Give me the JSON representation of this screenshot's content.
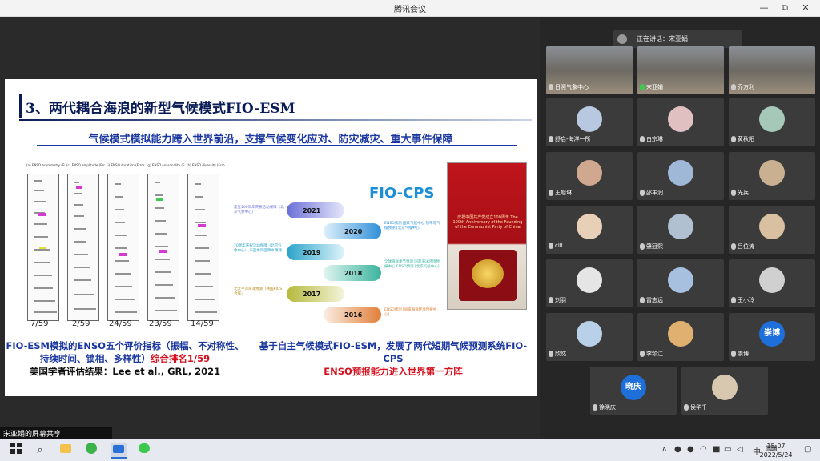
{
  "window": {
    "title": "腾讯会议",
    "min": "—",
    "max": "⧉",
    "close": "✕"
  },
  "slide": {
    "title": "3、两代耦合海浪的新型气候模式FIO-ESM",
    "subtitle": "气候模式模拟能力跨入世界前沿，支撑气候变化应对、防灾减灾、重大事件保障",
    "panel_headers": [
      "(a) ENSO asymmetry (Error %)",
      "(c) ENSO amplitude (Error %)",
      "(i) ENSO duration (Error %)",
      "(g) ENSO seasonality (Error %)",
      "(h) ENSO diversity (Error %)"
    ],
    "ranks": [
      "7/59",
      "2/59",
      "24/59",
      "23/59",
      "14/59"
    ],
    "caption_left_1": "FIO-ESM模拟的ENSO五个评价指标（振幅、不对称性、持续时间、锁相、多样性）",
    "caption_left_red": "综合排名1/59",
    "caption_left_2": "美国学者评估结果：Lee et al., GRL, 2021",
    "fio_cps": "FIO-CPS",
    "caption_right_1": "基于自主气候模式FIO-ESM，发展了两代短期气候预测系统FIO-CPS",
    "caption_right_red": "ENSO预报能力进入世界第一方阵",
    "timeline": [
      {
        "year": "2021",
        "note": "建党100周年庆祝活动保障（北京气象中心）",
        "color": "#6b6fd6"
      },
      {
        "year": "2020",
        "note": "ENSO预测 国家气候中心 热带与气候预测 [北京气候中心]",
        "color": "#2f8fd8"
      },
      {
        "year": "2019",
        "note": "70周年庆祝活动保障（北京气象中心） 东亚季风区降水预测",
        "color": "#2aa3c9"
      },
      {
        "year": "2018",
        "note": "全球海洋季节预测 国家海洋环境预报中心 ENSO预测 [北京气候中心]",
        "color": "#3bb39e"
      },
      {
        "year": "2017",
        "note": "北太平洋海洋预测（韩国KIOST合作）",
        "color": "#b6b83a"
      },
      {
        "year": "2016",
        "note": "ENSO预测 [国家海洋环境预报中心]",
        "color": "#e17f3a"
      }
    ],
    "photo_text": "庆祝中国共产党成立100周年 The 100th Anniversary of the Founding of the Communist Party of China"
  },
  "speaking": {
    "label": "正在讲话：宋亚娟"
  },
  "participants": [
    {
      "name": "日照气象中心",
      "avatar": "video",
      "mic": "off"
    },
    {
      "name": "宋亚娟",
      "avatar": "video",
      "mic": "on"
    },
    {
      "name": "乔方利",
      "avatar": "video",
      "mic": "off"
    },
    {
      "name": "舒启-海洋一所",
      "avatar": "photo",
      "mic": "off"
    },
    {
      "name": "白宗琳",
      "avatar": "photo",
      "mic": "off"
    },
    {
      "name": "黄秋阳",
      "avatar": "photo",
      "mic": "off"
    },
    {
      "name": "王旭琳",
      "avatar": "photo",
      "mic": "off"
    },
    {
      "name": "邵丰润",
      "avatar": "photo",
      "mic": "off"
    },
    {
      "name": "光兵",
      "avatar": "photo",
      "mic": "off"
    },
    {
      "name": "clll",
      "avatar": "photo",
      "mic": "off"
    },
    {
      "name": "肇冠熙",
      "avatar": "photo",
      "mic": "off"
    },
    {
      "name": "吕位涛",
      "avatar": "photo",
      "mic": "off"
    },
    {
      "name": "刘羽",
      "avatar": "default",
      "mic": "off"
    },
    {
      "name": "雷志远",
      "avatar": "photo",
      "mic": "off"
    },
    {
      "name": "王小玲",
      "avatar": "photo",
      "mic": "off"
    },
    {
      "name": "欣然",
      "avatar": "photo",
      "mic": "off"
    },
    {
      "name": "李颂江",
      "avatar": "photo",
      "mic": "off"
    },
    {
      "name": "崇博",
      "avatar": "text",
      "avatar_text": "崇博",
      "mic": "off"
    },
    {
      "name": "徐晓庆",
      "avatar": "text",
      "avatar_text": "晓庆",
      "mic": "off"
    },
    {
      "name": "侯华千",
      "avatar": "photo",
      "mic": "off"
    }
  ],
  "share_label": "宋亚娟的屏幕共享",
  "taskbar": {
    "time": "15:07",
    "date": "2022/5/24",
    "lang": "中",
    "tray": "∧"
  }
}
